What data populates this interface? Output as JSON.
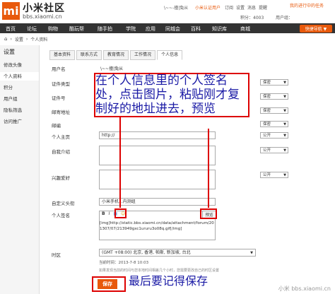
{
  "header": {
    "logo_glyph": "mi",
    "logo_title": "小米社区",
    "logo_sub": "bbs.xiaomi.cn",
    "top_links": [
      "\\~~-撞|兔从",
      "小米认证用户",
      "订阅",
      "设置",
      "消息",
      "提醒"
    ],
    "task_text": "我的进行中的任务",
    "points": "积分：4003",
    "user_group": "用户组：",
    "accent": "#e8590c"
  },
  "nav": {
    "items": [
      "首页",
      "论坛",
      "购物",
      "酷玩帮",
      "随手拍",
      "学院",
      "应用",
      "同城会",
      "百科",
      "知识库",
      "商城"
    ],
    "quick_button": "快捷导航 ▼"
  },
  "breadcrumb": [
    "设置",
    "个人资料"
  ],
  "sidebar": {
    "title": "设置",
    "items": [
      "修改头像",
      "个人资料",
      "积分",
      "用户组",
      "隐私筛选",
      "访问推广"
    ]
  },
  "tabs": [
    "基本资料",
    "联系方式",
    "教育情况",
    "工作情况",
    "个人信息"
  ],
  "form": {
    "rows": [
      {
        "label": "用户名",
        "value": "\\~~撞|兔从",
        "privacy": ""
      },
      {
        "label": "证件类型",
        "value": "",
        "privacy": "保密"
      },
      {
        "label": "证件号",
        "value": "",
        "privacy": "保密"
      },
      {
        "label": "邮寄地址",
        "value": "",
        "privacy": "保密"
      },
      {
        "label": "邮编",
        "value": "",
        "privacy": "保密"
      },
      {
        "label": "个人主页",
        "value": "http://",
        "privacy": "公开"
      },
      {
        "label": "自我介绍",
        "value": "",
        "privacy": "公开"
      },
      {
        "label": "兴趣爱好",
        "value": "",
        "privacy": "公开"
      },
      {
        "label": "自定义头衔",
        "value": "小米手机...内测组",
        "privacy": ""
      },
      {
        "label": "个人签名",
        "value": "",
        "privacy": ""
      },
      {
        "label": "时区",
        "value": "(GMT +08:00) 北京, 香港, 帕斯, 新加坡, 台北",
        "privacy": ""
      }
    ],
    "signature_text": "[img]http://static.bbs.xiaomi.cn/data/attachment/forum/201307/07/213949gxc1ururu3o08q.gif[/img]",
    "preview_label": "预览",
    "toolbar": [
      "B",
      "I",
      "▣",
      "☺"
    ],
    "current_time": "当前时间：2013-7-8 10:03",
    "note": "如果发现当前的时间与您本地时间相差几个小时，您需要更改自己的时区设置",
    "save_label": "保存"
  },
  "annotations": {
    "main": "在个人信息里的个人签名处，点击图片，粘贴刚才复制好的地址进去，预览",
    "save": "最后要记得保存",
    "color": "#1a1aa5",
    "box_color": "#d00"
  },
  "watermark": "小米 bbs.xiaomi.cn"
}
